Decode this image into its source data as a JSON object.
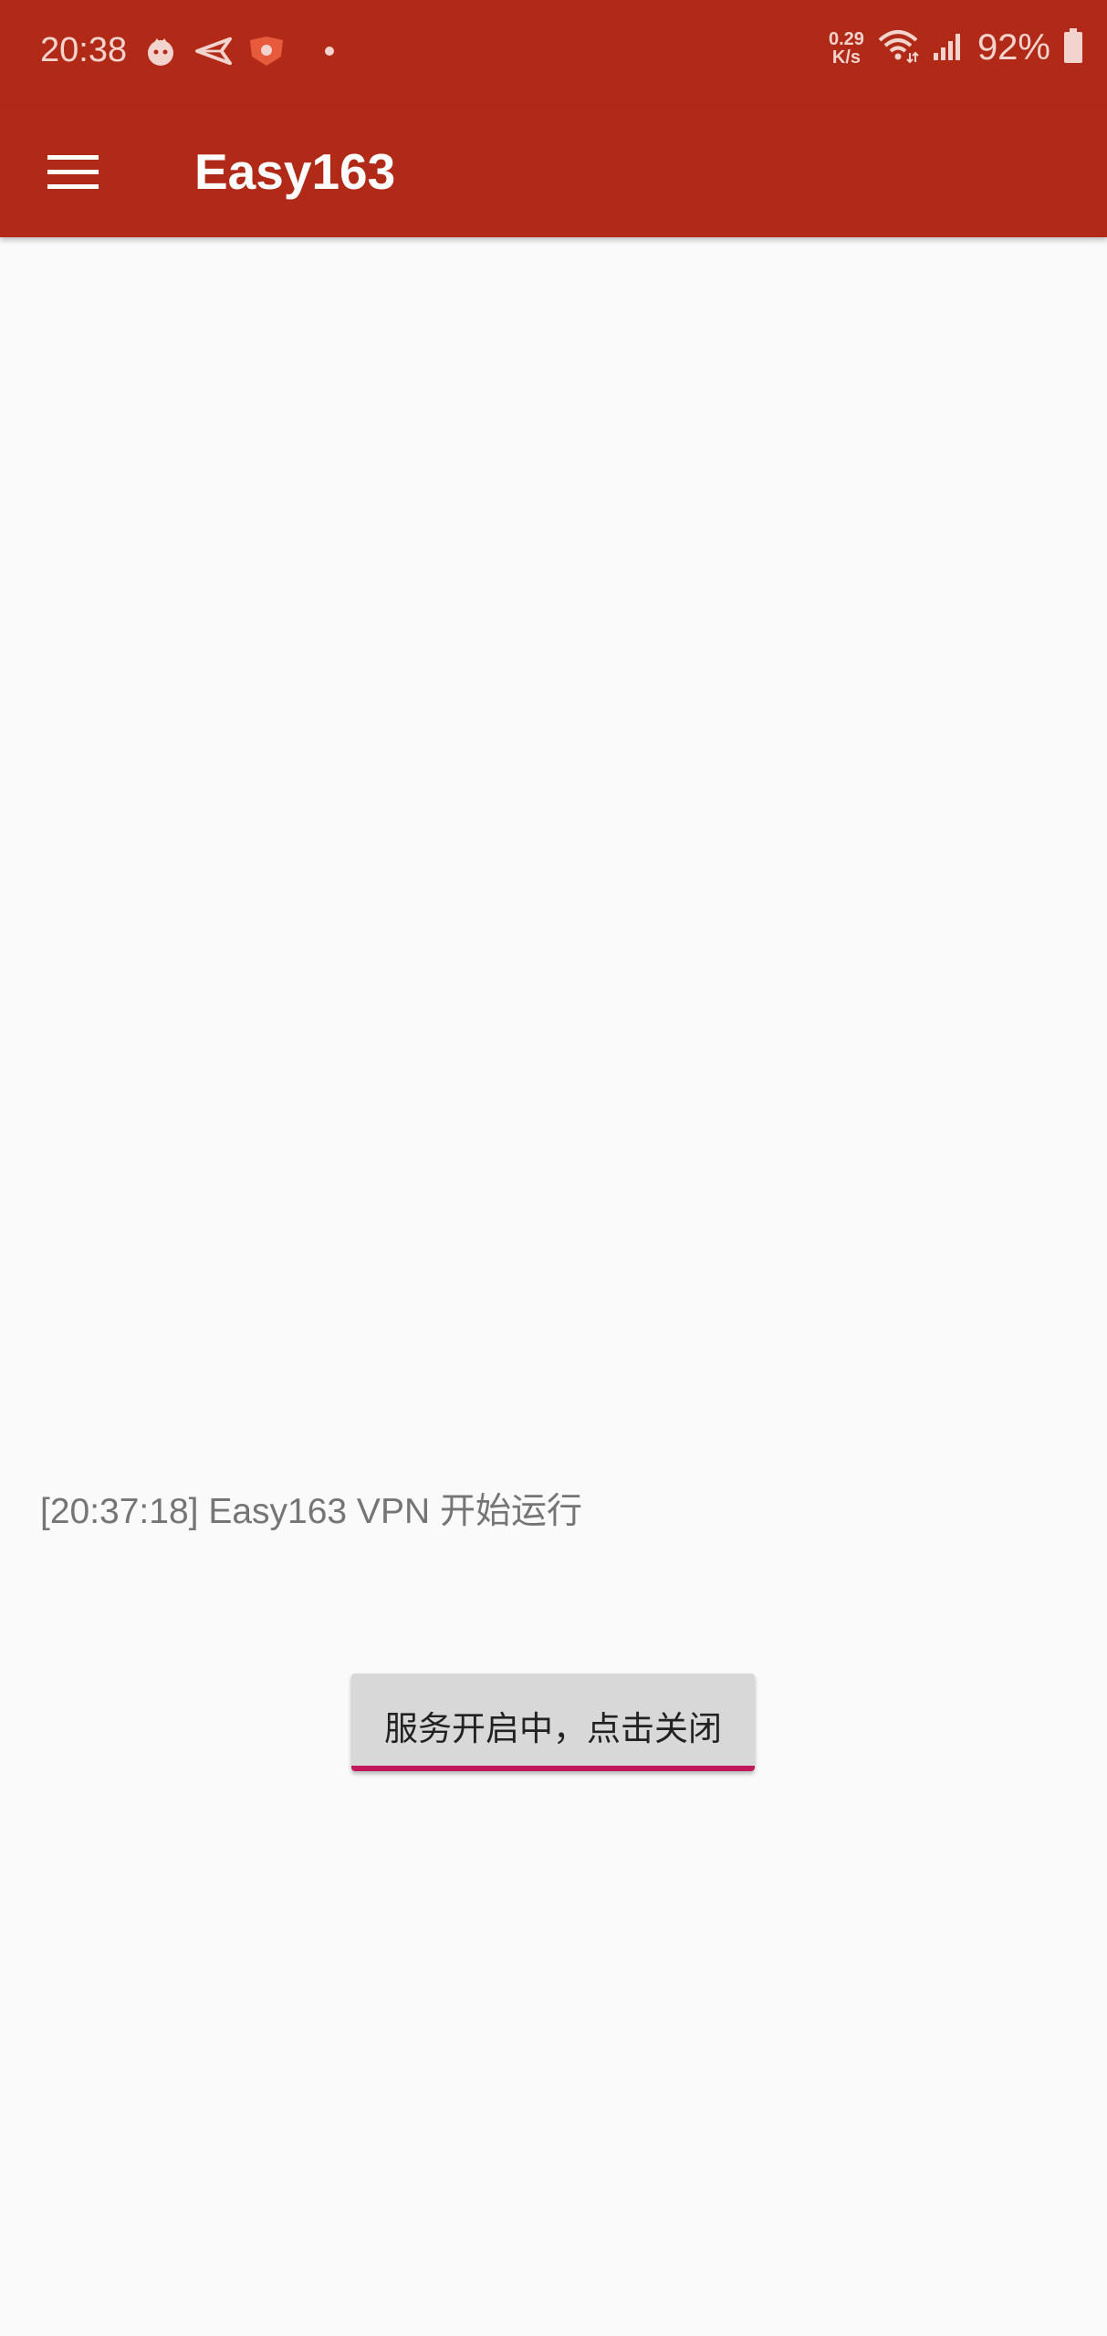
{
  "status_bar": {
    "time": "20:38",
    "net_speed_value": "0.29",
    "net_speed_unit": "K/s",
    "battery": "92%",
    "icons": [
      "notification-app-icon",
      "send-icon",
      "shield-app-icon",
      "dot-icon",
      "wifi-icon",
      "signal-icon",
      "battery-icon"
    ]
  },
  "app_bar": {
    "menu_icon": "hamburger-menu-icon",
    "title": "Easy163"
  },
  "main": {
    "log_line": "[20:37:18] Easy163 VPN 开始运行",
    "toggle_button_label": "服务开启中，点击关闭"
  },
  "colors": {
    "app_bar": "#b12a17",
    "background": "#fafafa",
    "button_bg": "#d8d8d8",
    "button_accent": "#c2185b",
    "log_text": "#757575"
  }
}
